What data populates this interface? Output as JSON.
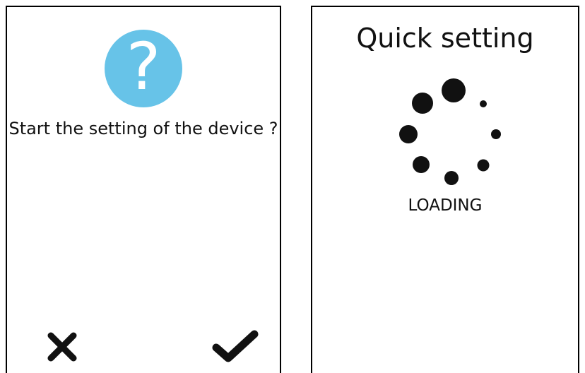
{
  "setup_dialog": {
    "help_glyph": "?",
    "help_icon": "question-mark-icon",
    "help_color": "#67c3e8",
    "prompt": "Start the setting of the device ?",
    "cancel_icon": "close-icon",
    "confirm_icon": "checkmark-icon"
  },
  "loading_screen": {
    "title": "Quick setting",
    "status": "LOADING",
    "spinner_icon": "loading-spinner-icon"
  }
}
